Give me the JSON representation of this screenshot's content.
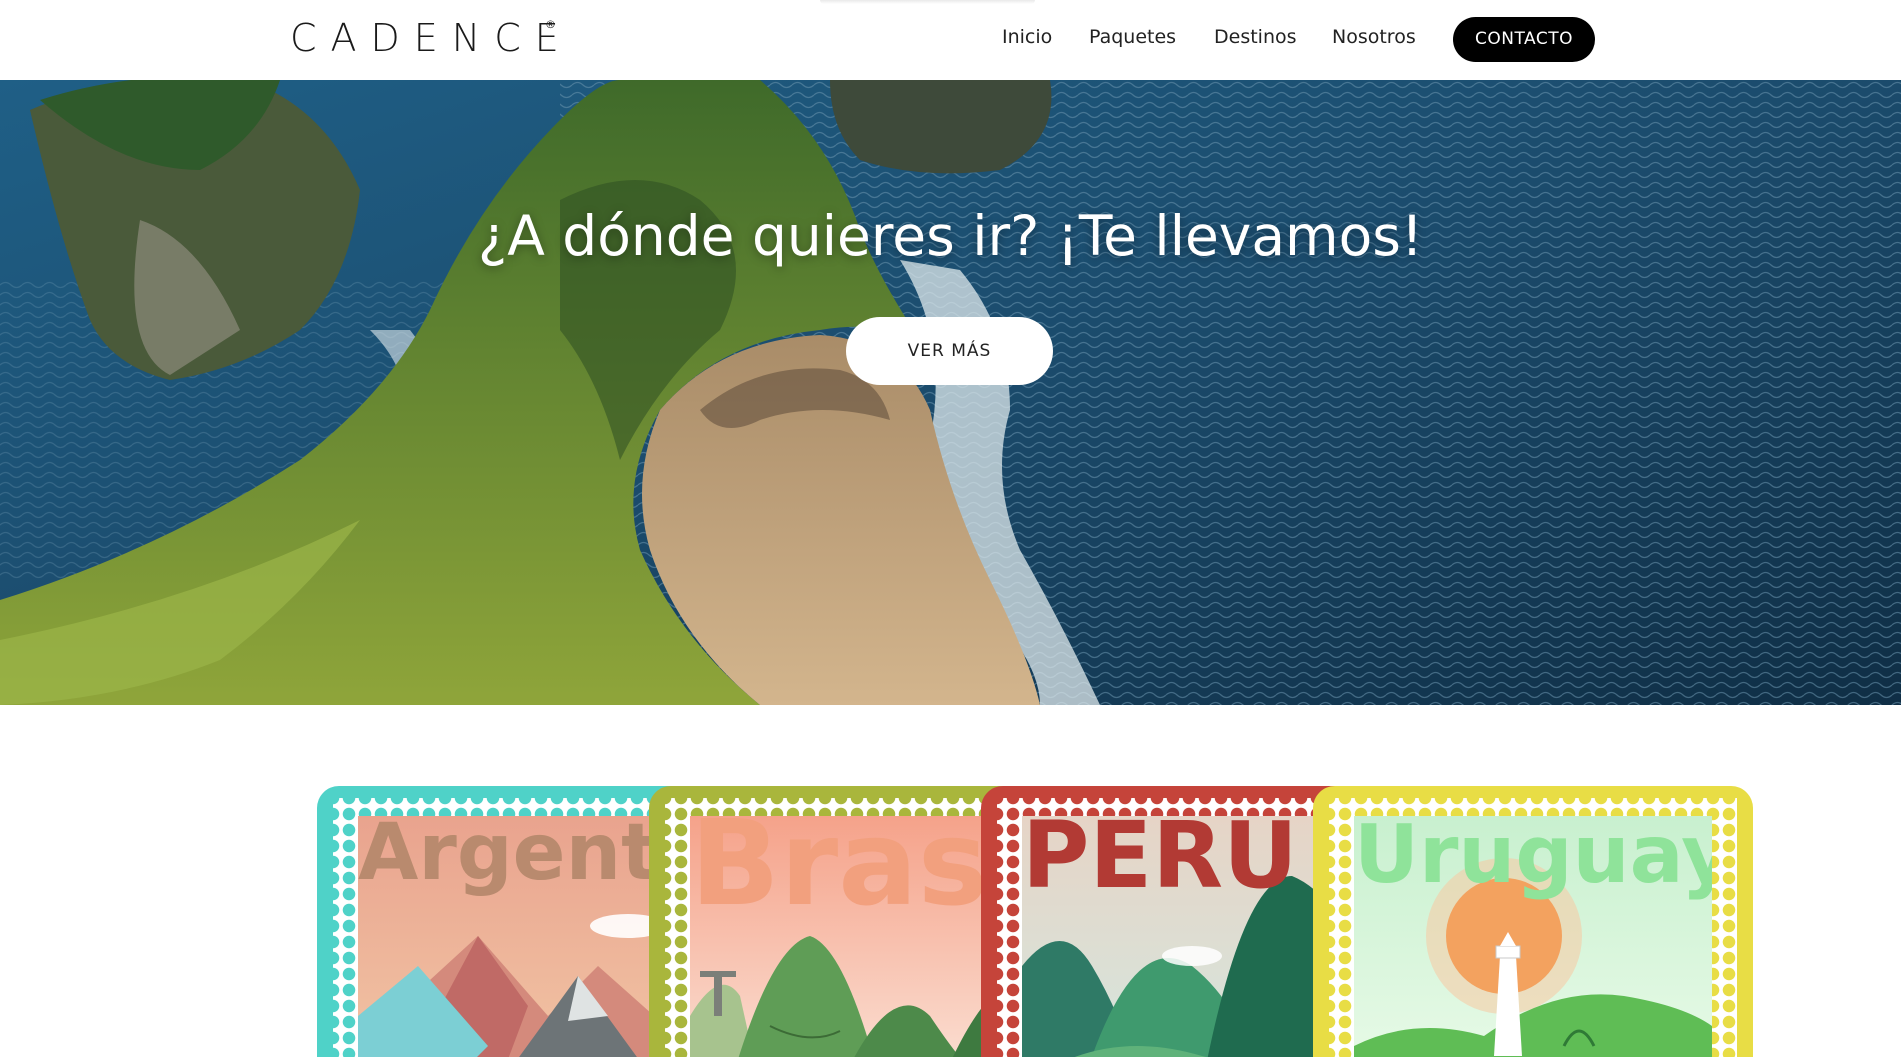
{
  "header": {
    "logo": "CADENCE",
    "logo_mark": "®",
    "nav": {
      "inicio": "Inicio",
      "paquetes": "Paquetes",
      "destinos": "Destinos",
      "nosotros": "Nosotros"
    },
    "cta": "CONTACTO"
  },
  "hero": {
    "title": "¿A dónde quieres ir? ¡Te llevamos!",
    "button": "VER MÁS"
  },
  "stamps": [
    {
      "word": "Argentin",
      "frame_color": "#4fd2c8",
      "text_color": "#b98a6e"
    },
    {
      "word": "Bras",
      "frame_color": "#a9b63c",
      "text_color": "#f2a07e"
    },
    {
      "word": "PERÚ",
      "frame_color": "#c5443a",
      "text_color": "#b23a34"
    },
    {
      "word": "Uruguay",
      "frame_color": "#e8dd45",
      "text_color": "#8fe39a"
    }
  ],
  "colors": {
    "cta_bg": "#000000",
    "ocean": "#1d4a6e"
  }
}
